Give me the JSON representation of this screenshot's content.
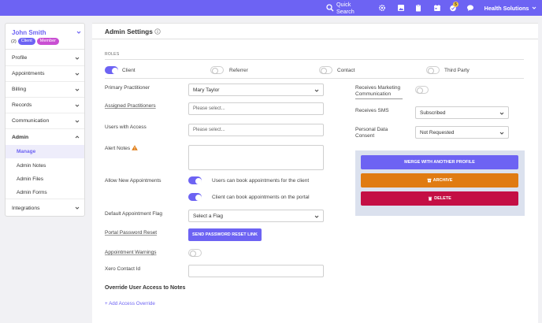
{
  "topbar": {
    "search_label": "Quick Search",
    "notification_count": "5",
    "org_name": "Health Solutions"
  },
  "user": {
    "name": "John Smith",
    "count": "(2)",
    "tags": [
      "Client",
      "Member"
    ]
  },
  "sidebar": {
    "items": [
      {
        "label": "Profile"
      },
      {
        "label": "Appointments"
      },
      {
        "label": "Billing"
      },
      {
        "label": "Records"
      },
      {
        "label": "Communication"
      },
      {
        "label": "Admin"
      }
    ],
    "admin_sub": [
      {
        "label": "Manage"
      },
      {
        "label": "Admin Notes"
      },
      {
        "label": "Admin Files"
      },
      {
        "label": "Admin Forms"
      }
    ],
    "integrations": "Integrations"
  },
  "main": {
    "title": "Admin Settings",
    "roles_heading": "ROLES",
    "roles": [
      {
        "label": "Client",
        "on": true
      },
      {
        "label": "Referrer",
        "on": false
      },
      {
        "label": "Contact",
        "on": false
      },
      {
        "label": "Third Party",
        "on": false
      }
    ],
    "primary_practitioner": {
      "label": "Primary Practitioner",
      "value": "Mary Taylor"
    },
    "assigned_practitioners": {
      "label": "Assigned Practitioners",
      "placeholder": "Please select..."
    },
    "users_with_access": {
      "label": "Users with Access",
      "placeholder": "Please select..."
    },
    "alert_notes": {
      "label": "Alert Notes"
    },
    "allow_new_appointments": {
      "label": "Allow New Appointments",
      "options": [
        {
          "label": "Users can book appointments for the client",
          "on": true
        },
        {
          "label": "Client can book appointments on the portal",
          "on": true
        }
      ]
    },
    "default_appointment_flag": {
      "label": "Default Appointment Flag",
      "value": "Select a Flag"
    },
    "portal_password_reset": {
      "label": "Portal Password Reset",
      "button": "SEND PASSWORD RESET LINK"
    },
    "appointment_warnings": {
      "label": "Appointment Warnings",
      "on": false
    },
    "xero_contact_id": {
      "label": "Xero Contact Id",
      "value": ""
    },
    "override_title": "Override User Access to Notes",
    "add_access_override": "+ Add Access Override",
    "receives_marketing": {
      "label": "Receives Marketing Communication",
      "on": false
    },
    "receives_sms": {
      "label": "Receives SMS",
      "value": "Subscribed"
    },
    "personal_data_consent": {
      "label": "Personal Data Consent",
      "value": "Not Requested"
    },
    "actions": {
      "merge": "MERGE WITH ANOTHER PROFILE",
      "archive": "ARCHIVE",
      "delete": "DELETE"
    }
  },
  "colors": {
    "accent": "#6d63f3",
    "member_pill": "#c94fd3",
    "archive": "#e07b12",
    "delete": "#c40f45",
    "warning": "#e07b12"
  }
}
